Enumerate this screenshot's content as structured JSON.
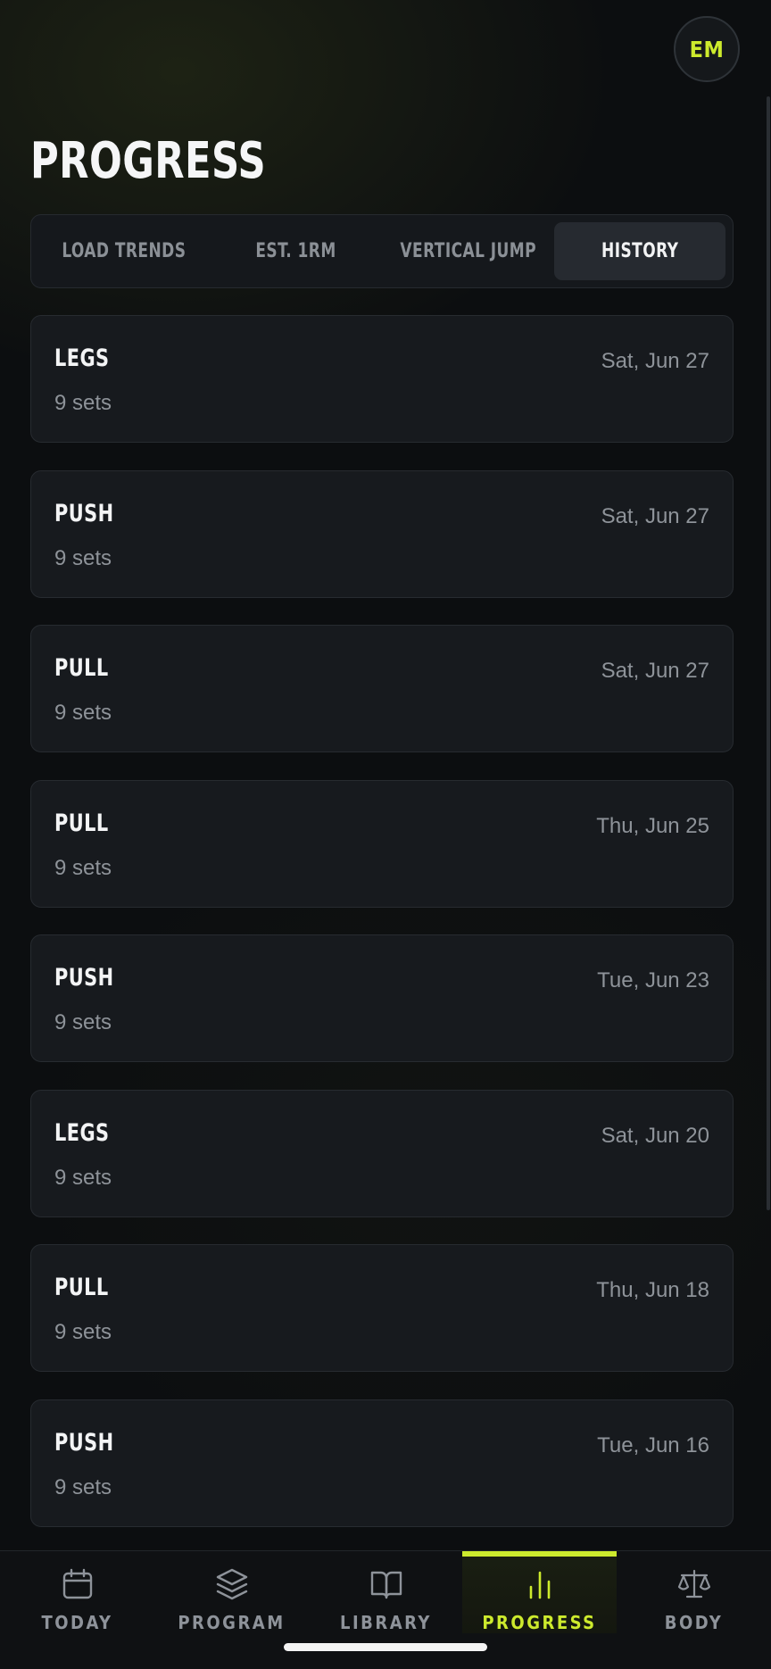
{
  "header": {
    "avatar_initials": "EM",
    "title": "PROGRESS"
  },
  "tabs": [
    {
      "label": "LOAD TRENDS",
      "active": false
    },
    {
      "label": "EST. 1RM",
      "active": false
    },
    {
      "label": "VERTICAL JUMP",
      "active": false
    },
    {
      "label": "HISTORY",
      "active": true
    }
  ],
  "history": [
    {
      "name": "LEGS",
      "sets": "9 sets",
      "date": "Sat, Jun 27"
    },
    {
      "name": "PUSH",
      "sets": "9 sets",
      "date": "Sat, Jun 27"
    },
    {
      "name": "PULL",
      "sets": "9 sets",
      "date": "Sat, Jun 27"
    },
    {
      "name": "PULL",
      "sets": "9 sets",
      "date": "Thu, Jun 25"
    },
    {
      "name": "PUSH",
      "sets": "9 sets",
      "date": "Tue, Jun 23"
    },
    {
      "name": "LEGS",
      "sets": "9 sets",
      "date": "Sat, Jun 20"
    },
    {
      "name": "PULL",
      "sets": "9 sets",
      "date": "Thu, Jun 18"
    },
    {
      "name": "PUSH",
      "sets": "9 sets",
      "date": "Tue, Jun 16"
    }
  ],
  "nav": [
    {
      "label": "TODAY",
      "icon": "calendar-icon",
      "active": false
    },
    {
      "label": "PROGRAM",
      "icon": "layers-icon",
      "active": false
    },
    {
      "label": "LIBRARY",
      "icon": "book-icon",
      "active": false
    },
    {
      "label": "PROGRESS",
      "icon": "bar-chart-icon",
      "active": true
    },
    {
      "label": "BODY",
      "icon": "scale-icon",
      "active": false
    }
  ],
  "colors": {
    "accent": "#cdea2d",
    "background": "#0c0e10",
    "card": "#171a1e",
    "muted_text": "#8e9399"
  }
}
